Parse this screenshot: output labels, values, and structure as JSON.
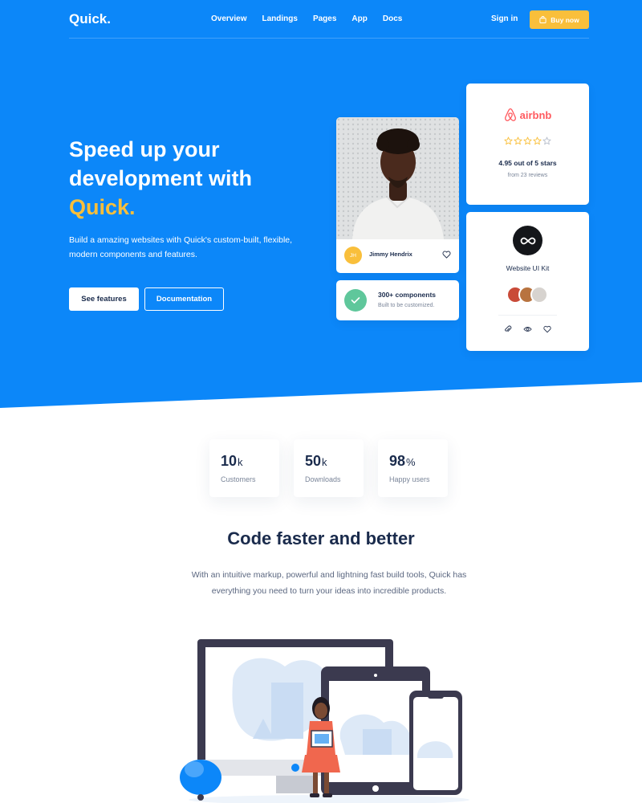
{
  "colors": {
    "primary": "#0c87f9",
    "accent": "#f9bf3b",
    "success": "#5fc79b",
    "airbnb": "#ff5a5f",
    "text": "#1a2b4c"
  },
  "nav": {
    "logo": "Quick.",
    "links": [
      "Overview",
      "Landings",
      "Pages",
      "App",
      "Docs"
    ],
    "signin": "Sign in",
    "buy": "Buy now",
    "buy_icon": "shopping-bag-icon"
  },
  "hero": {
    "headline": "Speed up your development with",
    "headline_accent": "Quick.",
    "subtext": "Build a amazing websites with Quick's custom-built, flexible, modern components and features.",
    "btn_primary": "See features",
    "btn_secondary": "Documentation"
  },
  "person_card": {
    "initials": "JH",
    "name": "Jimmy Hendrix",
    "icon": "heart-icon"
  },
  "components_card": {
    "title": "300+ components",
    "subtitle": "Built to be customized.",
    "icon": "check-icon"
  },
  "airbnb_card": {
    "brand": "airbnb",
    "stars": 4,
    "stars_total": 5,
    "rating": "4.95 out of 5 stars",
    "reviews": "from 23 reviews"
  },
  "kit_card": {
    "title": "Website UI Kit",
    "actions": [
      "paperclip-icon",
      "eye-icon",
      "heart-icon"
    ]
  },
  "stats": [
    {
      "value": "10",
      "unit": "k",
      "label": "Customers"
    },
    {
      "value": "50",
      "unit": "k",
      "label": "Downloads"
    },
    {
      "value": "98",
      "unit": "%",
      "label": "Happy users"
    }
  ],
  "section": {
    "title": "Code faster and better",
    "text": "With an intuitive markup, powerful and lightning fast build tools, Quick has everything you need to turn your ideas into incredible products."
  }
}
